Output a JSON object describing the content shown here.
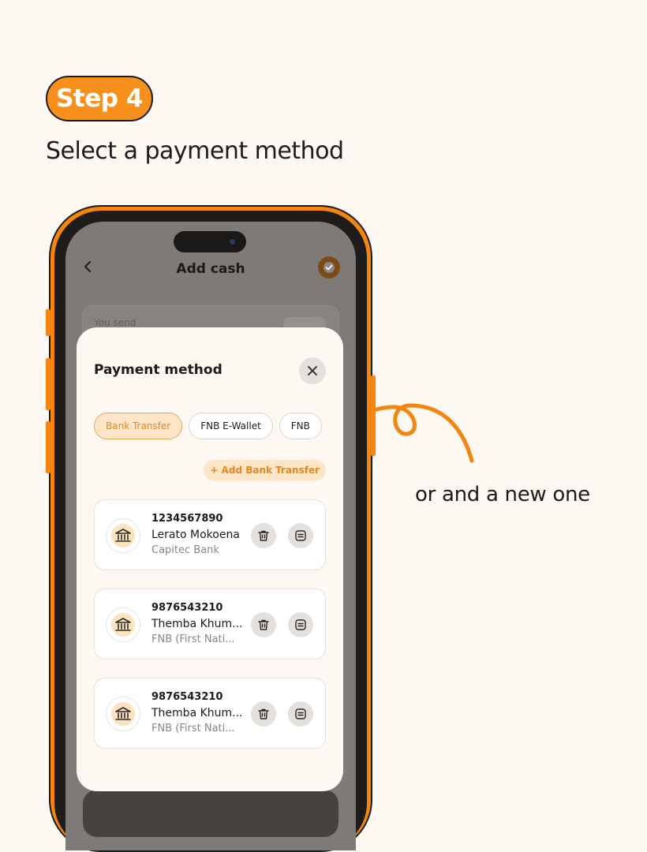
{
  "step_label": "Step 4",
  "headline": "Select a payment method",
  "side_note": "or and a new one",
  "screen": {
    "title": "Add cash",
    "you_send_label": "You send"
  },
  "sheet": {
    "title": "Payment method",
    "tabs": [
      {
        "label": "Bank Transfer",
        "active": true
      },
      {
        "label": "FNB E-Wallet",
        "active": false
      },
      {
        "label": "FNB",
        "active": false
      }
    ],
    "add_label": "+ Add Bank Transfer",
    "accounts": [
      {
        "number": "1234567890",
        "name": "Lerato Mokoena",
        "bank": "Capitec Bank"
      },
      {
        "number": "9876543210",
        "name": "Themba Khum...",
        "bank": "FNB (First Nati..."
      },
      {
        "number": "9876543210",
        "name": "Themba Khum...",
        "bank": "FNB (First Nati..."
      }
    ]
  },
  "colors": {
    "accent": "#f8901e",
    "accent_light": "#fde6c8",
    "background": "#fdf8f1",
    "text": "#1c1c1c"
  }
}
